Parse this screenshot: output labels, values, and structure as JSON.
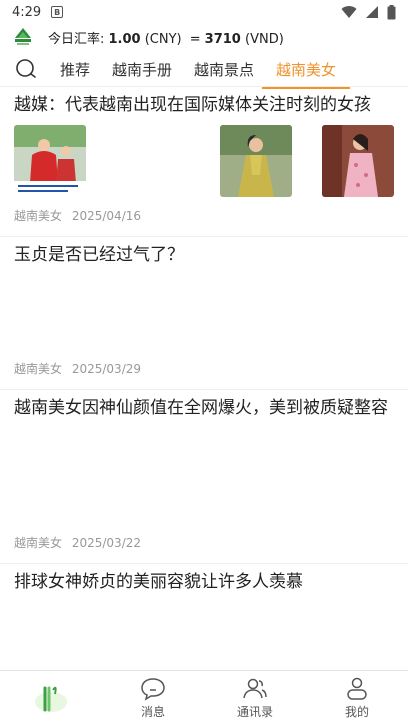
{
  "status": {
    "time": "4:29",
    "notification_badge": "B"
  },
  "header": {
    "rate_prefix": "今日汇率: ",
    "cny_amount": "1.00",
    "cny_code": "(CNY)",
    "equals": "=",
    "vnd_amount": "3710",
    "vnd_code": "(VND)"
  },
  "tabs": [
    {
      "label": "推荐"
    },
    {
      "label": "越南手册"
    },
    {
      "label": "越南景点"
    },
    {
      "label": "越南美女",
      "active": true
    }
  ],
  "colors": {
    "accent": "#f0932b",
    "meta": "#999999"
  },
  "articles": [
    {
      "title": "越媒：代表越南出现在国际媒体关注时刻的女孩",
      "category": "越南美女",
      "date": "2025/04/16"
    },
    {
      "title": "玉贞是否已经过气了？",
      "category": "越南美女",
      "date": "2025/03/29"
    },
    {
      "title": "越南美女因神仙颜值在全网爆火，美到被质疑整容",
      "category": "越南美女",
      "date": "2025/03/22"
    },
    {
      "title": "排球女神娇贞的美丽容貌让许多人羡慕"
    }
  ],
  "bottom_nav": [
    {
      "label": "",
      "icon": "home-icon"
    },
    {
      "label": "消息",
      "icon": "message-icon"
    },
    {
      "label": "通讯录",
      "icon": "contacts-icon"
    },
    {
      "label": "我的",
      "icon": "profile-icon"
    }
  ]
}
